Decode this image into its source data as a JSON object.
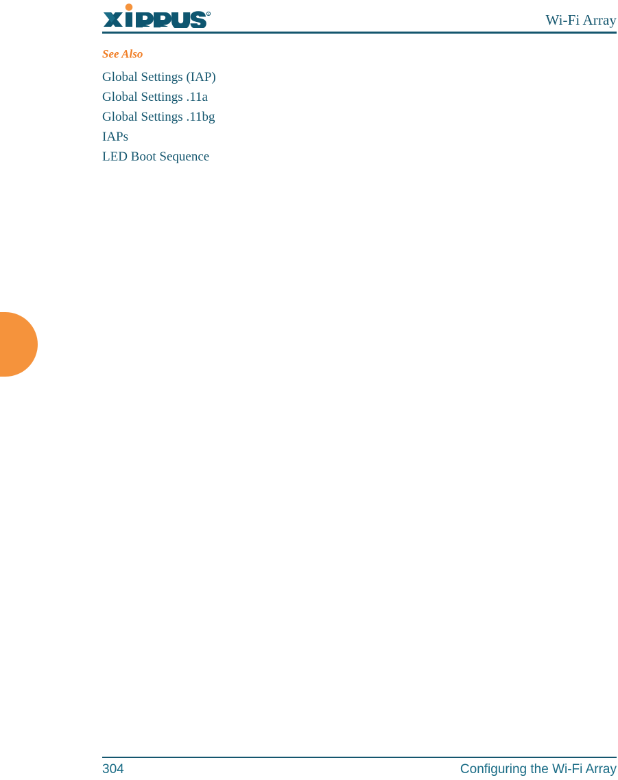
{
  "header": {
    "logo_name": "xirrus-logo",
    "logo_wordmark": "XIRRUS",
    "logo_trademark": "®",
    "title": "Wi-Fi Array"
  },
  "content": {
    "see_also_heading": "See Also",
    "cross_references": [
      {
        "label": "Global Settings (IAP)"
      },
      {
        "label": "Global Settings .11a"
      },
      {
        "label": "Global Settings .11bg"
      },
      {
        "label": "IAPs"
      },
      {
        "label": "LED Boot Sequence"
      }
    ]
  },
  "footer": {
    "page_number": "304",
    "chapter_title": "Configuring the Wi-Fi Array"
  },
  "colors": {
    "teal": "#14566E",
    "teal_light": "#176A84",
    "orange": "#F5933C",
    "orange_heading": "#F07E26",
    "logo_dark": "#0E5670",
    "logo_mid": "#1A6C86"
  }
}
